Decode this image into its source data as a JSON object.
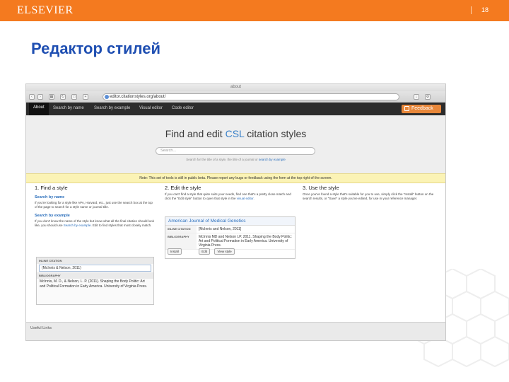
{
  "slide": {
    "brand": "ELSEVIER",
    "page_number": "18",
    "title": "Редактор стилей"
  },
  "browser": {
    "window_title": "about",
    "url": "editor.citationstyles.org/about/",
    "toolbar_icons": [
      "back-icon",
      "forward-icon",
      "tabs-icon",
      "reload-icon",
      "bookmark-icon",
      "share-icon"
    ]
  },
  "nav": {
    "items": [
      "About",
      "Search by name",
      "Search by example",
      "Visual editor",
      "Code editor"
    ],
    "active": "About",
    "feedback_label": "Feedback"
  },
  "hero": {
    "title_before": "Find and edit ",
    "title_accent": "CSL",
    "title_after": " citation styles",
    "search_placeholder": "Search...",
    "hint_text": "Search for the title of a style, the title of a journal or",
    "hint_link": "search by example"
  },
  "notice": "Note: This set of tools is still in public beta. Please report any bugs or feedback using the form at the top right of the screen.",
  "col1": {
    "heading": "1. Find a style",
    "link1": "Search by name",
    "text1": "If you're looking for a style like APA, Harvard, etc., just use the search box at the top of the page to search for a style name or journal title.",
    "link2": "Search by example",
    "text2a": "If you don't know the name of the style but know what all the final citation should look like, you should use",
    "text2_link": "Search by example",
    "text2b": ". Edit to find styles that most closely match.",
    "cite_label": "INLINE CITATION",
    "cite_value": "(McInnis & Nelson, 2011)",
    "bib_label": "BIBLIOGRAPHY",
    "bib_value": "McInnis, M. D., & Nelson, L. P. (2011). Shaping the Body Politic: Art and Political Formation in Early America. University of Virginia Press."
  },
  "col2": {
    "heading": "2. Edit the style",
    "text_a": "If you can't find a style that quite suits your needs, find one that's a pretty close match and click the \"Edit style\" button to open that style in the",
    "text_link": "visual editor",
    "text_b": ".",
    "box_title": "American Journal of Medical Genetics",
    "row1_label": "INLINE CITATION",
    "row1_value": "[McInnis and Nelson, 2011]",
    "row2_label": "BIBLIOGRAPHY",
    "row2_value": "McInnis MD and Nelson LP. 2011. Shaping the Body Politic: Art and Political Formation in Early America. University of Virginia Press.",
    "btn_install": "Install",
    "btn_edit": "Edit",
    "btn_view": "View style"
  },
  "col3": {
    "heading": "3. Use the style",
    "text": "Once you've found a style that's suitable for you to use, simply click the \"Install\" button on the search results, or \"Save\" a style you've edited, for use in your reference manager."
  },
  "footer": {
    "label": "Useful Links"
  },
  "colors": {
    "accent": "#f47a1f",
    "title": "#1f4fb2",
    "link": "#2a6ebb",
    "navbar": "#2c2c2c",
    "notice": "#fbf3b5"
  }
}
